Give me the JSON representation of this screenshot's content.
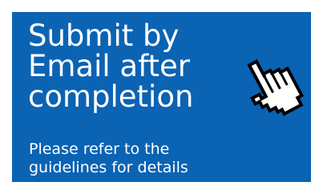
{
  "banner": {
    "background_color": "#0b63b3",
    "headline_lines": [
      "Submit by",
      "Email after",
      "completion"
    ],
    "subtext_lines": [
      "Please refer to the",
      "guidelines for details"
    ],
    "cursor_icon": "pointing-hand-cursor-icon"
  }
}
